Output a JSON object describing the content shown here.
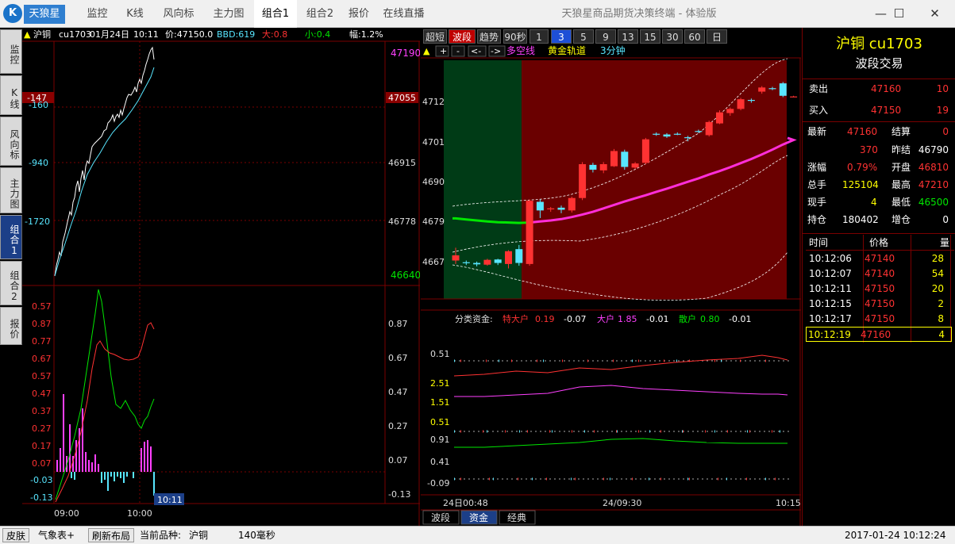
{
  "app": {
    "name": "天狼星",
    "window_title": "天狼星商品期货决策终端 - 体验版",
    "menu": [
      "监控",
      "K线",
      "风向标",
      "主力图",
      "组合1",
      "组合2",
      "报价",
      "在线直播"
    ],
    "active_menu": "组合1"
  },
  "left_tabs": [
    "监控",
    "K线",
    "风向标",
    "主力图",
    "组合1",
    "组合2",
    "报价"
  ],
  "timeshare": {
    "header": {
      "name": "沪铜",
      "code": "cu1703",
      "date": "01月24日",
      "time": "10:11",
      "price": "价:47150.0",
      "bbd": "BBD:619",
      "big": "大:0.8",
      "small": "小:0.4",
      "amplitude": "幅:1.2%"
    },
    "left_axis": [
      "-147",
      "-160",
      "-940",
      "-1720"
    ],
    "right_axis": [
      "47190",
      "47055",
      "46915",
      "46778",
      "46640"
    ],
    "x_axis": [
      "09:00",
      "10:00"
    ],
    "cursor_time": "10:11",
    "sub_axis": [
      "0.57",
      "0.87",
      "0.77",
      "0.67",
      "0.57",
      "0.47",
      "0.37",
      "0.27",
      "0.17",
      "0.07",
      "-0.03",
      "-0.13"
    ],
    "sub_axis_right": [
      "0.87",
      "0.67",
      "0.47",
      "0.27",
      "0.07",
      "-0.13"
    ]
  },
  "toolbar": {
    "modes": [
      "超短",
      "波段",
      "趋势"
    ],
    "active_mode": "波段",
    "periods": [
      "90秒",
      "1",
      "3",
      "5",
      "9",
      "13",
      "15",
      "30",
      "60",
      "日"
    ],
    "active_period": "3"
  },
  "kline": {
    "nav": [
      "+",
      "-",
      "<-",
      "->"
    ],
    "legend": [
      "多空线",
      "黄金轨道",
      "3分钟"
    ],
    "y_axis": [
      "4712",
      "4701",
      "4690",
      "4679",
      "4667"
    ],
    "candles": [
      [
        4665.5,
        4667.0,
        4664.5,
        4669.2
      ],
      [
        4665.0,
        4664.8,
        4664.2,
        4665.5
      ],
      [
        4664.8,
        4664.4,
        4663.8,
        4665.2
      ],
      [
        4664.3,
        4665.7,
        4664.0,
        4666.0
      ],
      [
        4665.8,
        4664.8,
        4664.2,
        4666.0
      ],
      [
        4664.5,
        4668.2,
        4663.2,
        4668.5
      ],
      [
        4668.8,
        4664.8,
        4664.0,
        4670.0
      ],
      [
        4664.5,
        4682.8,
        4664.0,
        4683.2
      ],
      [
        4682.5,
        4680.0,
        4677.8,
        4683.2
      ],
      [
        4680.4,
        4680.6,
        4679.6,
        4681.0
      ],
      [
        4680.8,
        4680.2,
        4679.2,
        4681.4
      ],
      [
        4680.0,
        4683.6,
        4679.4,
        4684.0
      ],
      [
        4683.6,
        4693.4,
        4683.0,
        4694.0
      ],
      [
        4693.2,
        4691.8,
        4691.0,
        4693.8
      ],
      [
        4691.6,
        4693.4,
        4690.8,
        4694.0
      ],
      [
        4692.8,
        4697.2,
        4692.6,
        4697.8
      ],
      [
        4697.0,
        4692.6,
        4691.8,
        4697.6
      ],
      [
        4692.4,
        4693.6,
        4692.0,
        4694.0
      ],
      [
        4693.8,
        4700.6,
        4693.4,
        4701.0
      ],
      [
        4702.2,
        4702.0,
        4701.6,
        4702.6
      ],
      [
        4702.0,
        4701.4,
        4701.0,
        4702.4
      ],
      [
        4702.2,
        4702.0,
        4701.8,
        4702.6
      ],
      [
        4701.2,
        4701.0,
        4700.0,
        4701.6
      ],
      [
        4703.0,
        4702.8,
        4702.4,
        4703.4
      ],
      [
        4701.8,
        4705.6,
        4701.4,
        4706.0
      ],
      [
        4705.2,
        4708.4,
        4705.0,
        4709.0
      ],
      [
        4708.2,
        4709.4,
        4707.4,
        4709.8
      ],
      [
        4709.4,
        4712.2,
        4709.0,
        4712.6
      ],
      [
        4712.0,
        4711.8,
        4711.2,
        4712.4
      ],
      [
        4714.4,
        4715.6,
        4713.8,
        4716.0
      ],
      [
        4715.4,
        4715.2,
        4714.8,
        4715.8
      ],
      [
        4716.8,
        4713.2,
        4712.8,
        4717.2
      ],
      [
        4713.0,
        4713.0,
        4712.8,
        4713.2
      ]
    ],
    "duokong_line": [
      4677.7,
      4677.4,
      4677.1,
      4676.8,
      4676.6,
      4676.5,
      4676.4,
      4676.5,
      4676.8,
      4677.1,
      4677.5,
      4678.1,
      4678.8,
      4679.6,
      4680.6,
      4681.6,
      4682.6,
      4683.5,
      4684.4,
      4685.4,
      4686.3,
      4687.3,
      4688.3,
      4689.3,
      4690.4,
      4691.4,
      4692.5,
      4693.7,
      4694.9,
      4696.2,
      4697.6,
      4699.1,
      4700.4
    ],
    "time_axis": [
      "24日00:48",
      "24/09:30",
      "10:15"
    ]
  },
  "capital": {
    "title": "分类资金:",
    "items": [
      {
        "label": "特大户",
        "value": "0.19",
        "change": "-0.07"
      },
      {
        "label": "大户",
        "value": "1.85",
        "change": "-0.01"
      },
      {
        "label": "散户",
        "value": "0.80",
        "change": "-0.01"
      }
    ],
    "y_axis": [
      "0.51",
      "2.51",
      "1.51",
      "0.51",
      "0.91",
      "0.41",
      "-0.09"
    ]
  },
  "bottom_tabs": [
    "波段",
    "资金",
    "经典"
  ],
  "active_bottom_tab": "资金",
  "quote": {
    "name": "沪铜 cu1703",
    "subtitle": "波段交易",
    "sell": {
      "label": "卖出",
      "price": "47160",
      "vol": "10"
    },
    "buy": {
      "label": "买入",
      "price": "47150",
      "vol": "19"
    },
    "stats": [
      {
        "l1": "最新",
        "v1": "47160",
        "l2": "结算",
        "v2": "0"
      },
      {
        "l1": "",
        "v1": "370",
        "l2": "昨结",
        "v2": "46790"
      },
      {
        "l1": "涨幅",
        "v1": "0.79%",
        "l2": "开盘",
        "v2": "46810"
      },
      {
        "l1": "总手",
        "v1": "125104",
        "l2": "最高",
        "v2": "47210"
      },
      {
        "l1": "现手",
        "v1": "4",
        "l2": "最低",
        "v2": "46500"
      },
      {
        "l1": "持仓",
        "v1": "180402",
        "l2": "增仓",
        "v2": "0"
      }
    ],
    "ticks_header": [
      "时间",
      "价格",
      "量"
    ],
    "ticks": [
      {
        "time": "10:12:06",
        "price": "47140",
        "vol": "28"
      },
      {
        "time": "10:12:07",
        "price": "47140",
        "vol": "54"
      },
      {
        "time": "10:12:11",
        "price": "47150",
        "vol": "20"
      },
      {
        "time": "10:12:15",
        "price": "47150",
        "vol": "2"
      },
      {
        "time": "10:12:17",
        "price": "47150",
        "vol": "8"
      },
      {
        "time": "10:12:19",
        "price": "47160",
        "vol": "4"
      }
    ]
  },
  "statusbar": {
    "skin": "皮肤",
    "weather": "气象表+",
    "refresh": "刷新布局",
    "current_label": "当前品种:",
    "current_value": "沪铜",
    "latency": "140毫秒",
    "datetime": "2017-01-24  10:12:24"
  },
  "colors": {
    "up": "#ff3232",
    "down": "#58e6ff",
    "bull_zone": "#6a0000",
    "bear_zone": "#003b16"
  }
}
